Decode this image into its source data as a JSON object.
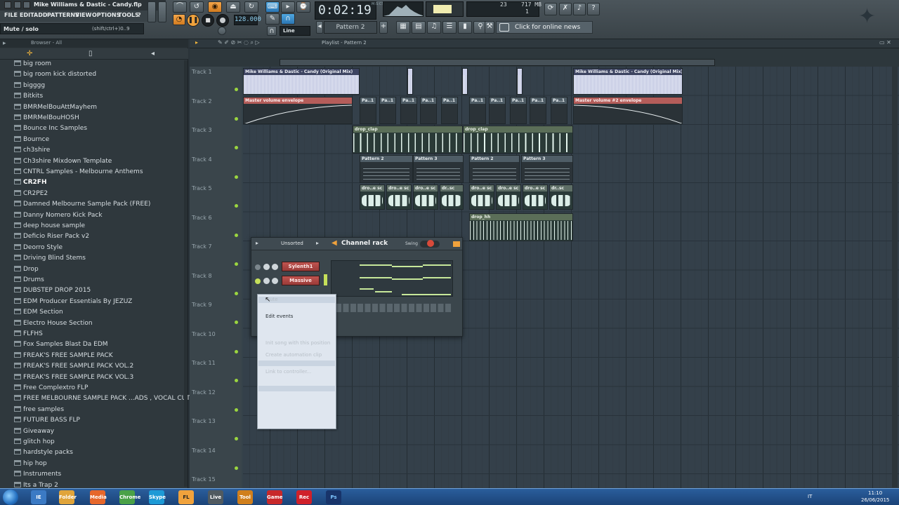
{
  "window": {
    "title": "Mike Williams & Dastic - Candy.flp"
  },
  "menu": [
    "FILE",
    "EDIT",
    "ADD",
    "PATTERNS",
    "VIEW",
    "OPTIONS",
    "TOOLS",
    "?"
  ],
  "hint": {
    "text": "Mute / solo",
    "shortcut": "(shift/ctrl+)0..9"
  },
  "transport": {
    "tempo": "128.000",
    "time": "0:02:19",
    "time_unit": "M:S:CS",
    "snap": "Line",
    "pattern": "Pattern 2",
    "cpu_voices": "23",
    "cpu_ram": "717 MB",
    "cpu_poly": "1"
  },
  "news": {
    "label": "Click for online news"
  },
  "browser": {
    "title": "Browser - All",
    "folders": [
      "big room",
      "big room kick distorted",
      "bigggg",
      "Bitkits",
      "BMRMelBouAttMayhem",
      "BMRMelBouHOSH",
      "Bounce Inc Samples",
      "Bournce",
      "ch3shire",
      "Ch3shire Mixdown Template",
      "CNTRL Samples - Melbourne Anthems",
      "CR2FH",
      "CR2PE2",
      "Damned Melbourne Sample Pack (FREE)",
      "Danny Nomero Kick Pack",
      "deep house sample",
      "Deficio Riser Pack v2",
      "Deorro  Style",
      "Driving Blind Stems",
      "Drop",
      "Drums",
      "DUBSTEP DROP 2015",
      "EDM Producer Essentials By JEZUZ",
      "EDM Section",
      "Electro House Section",
      "FLFHS",
      "Fox Samples Blast Da EDM",
      "FREAK'S FREE SAMPLE PACK",
      "FREAK'S FREE SAMPLE PACK VOL.2",
      "FREAK'S FREE SAMPLE PACK VOL.3",
      "Free Complextro FLP",
      "FREE MELBOURNE SAMPLE PACK ...ADS , VOCAL CUTS , KICKS ETC",
      "free samples",
      "FUTURE BASS FLP",
      "Giveaway",
      "glitch hop",
      "hardstyle packs",
      "hip hop",
      "Instruments",
      "Its a Trap 2"
    ],
    "selected_index": 11
  },
  "playlist": {
    "breadcrumb": "Playlist - Pattern 2",
    "bars": [
      "1",
      "2",
      "3",
      "4",
      "5",
      "6",
      "7",
      "8",
      "9",
      "10",
      "11",
      "12",
      "13",
      "14",
      "15",
      "16",
      "17",
      "18",
      "19",
      "20",
      "21",
      "22",
      "23",
      "24"
    ],
    "tracks": [
      "Track 1",
      "Track 2",
      "Track 3",
      "Track 4",
      "Track 5",
      "Track 6",
      "Track 7",
      "Track 8",
      "Track 9",
      "Track 10",
      "Track 11",
      "Track 12",
      "Track 13",
      "Track 14",
      "Track 15"
    ],
    "clips": {
      "audio_main_1": "Mike Williams & Dastic - Candy (Original Mix)",
      "audio_main_2": "Mike Williams & Dastic - Candy (Original Mix)",
      "auto_master_1": "Master volume envelope",
      "auto_master_2": "Master volume #2 envelope",
      "pa_short": "Pa..1",
      "drop_clap": "drop_clap",
      "pattern_2": "Pattern 2",
      "pattern_3": "Pattern 3",
      "drop_sc": "dro..e sc",
      "drop_sc_last": "dr..sc",
      "drop_hh": "drop_hh"
    }
  },
  "channel_rack": {
    "title": "Channel rack",
    "filter": "Unsorted",
    "swing_label": "Swing",
    "channels": [
      "Sylenth1",
      "Massive"
    ]
  },
  "context_menu": {
    "items": [
      {
        "label": "Mute",
        "enabled": false
      },
      {
        "label": "Edit events",
        "enabled": true
      },
      {
        "label": "Init song with this position",
        "enabled": false
      },
      {
        "label": "Create automation clip",
        "enabled": false
      },
      {
        "label": "Link to controller...",
        "enabled": false
      }
    ]
  },
  "taskbar": {
    "apps": [
      "IE",
      "Folder",
      "Media",
      "Chrome",
      "Skype",
      "FL",
      "Live",
      "Tool",
      "Game",
      "Rec",
      "Ps"
    ],
    "lang": "IT",
    "time": "11:10",
    "date": "26/06/2015"
  },
  "colors": {
    "accent_orange": "#f0a23c",
    "channel_red": "#b04845",
    "automation_red": "#b45d5a",
    "audio_clip": "#cfd3ec"
  }
}
